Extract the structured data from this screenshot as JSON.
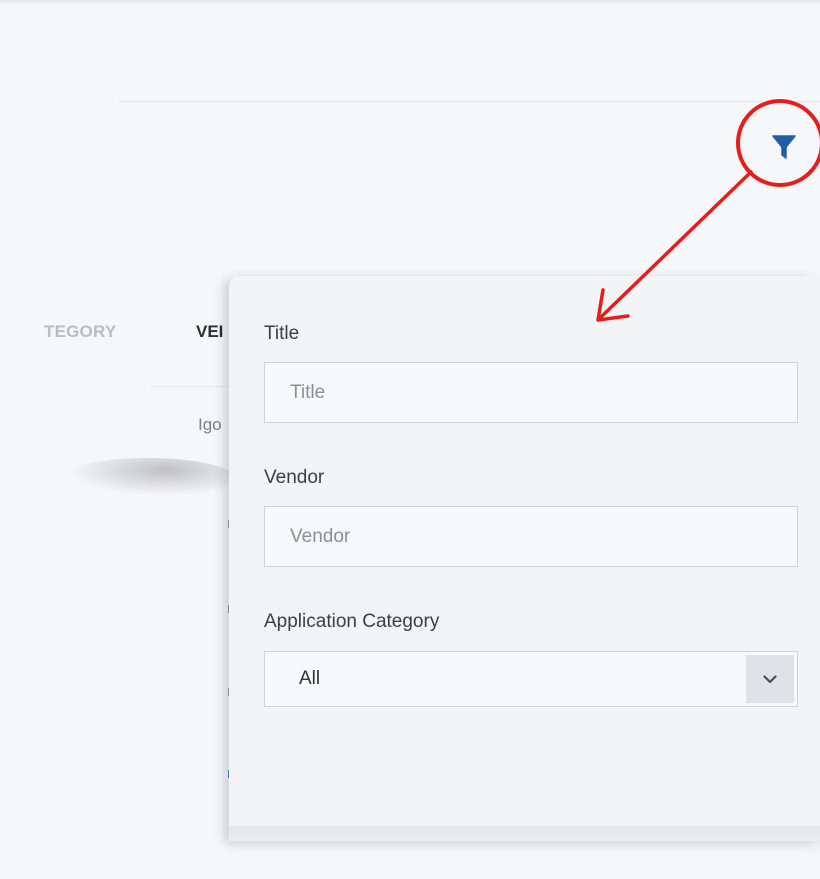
{
  "background": {
    "category_header": "TEGORY",
    "vendor_header": "VEI",
    "vendor_cell": "Igo"
  },
  "filter_button": {
    "icon": "filter-icon",
    "icon_color": "#1f5fa8"
  },
  "annotation": {
    "color": "#e51d1d",
    "shape": "circle-with-arrow"
  },
  "filter_panel": {
    "fields": {
      "title": {
        "label": "Title",
        "placeholder": "Title",
        "value": ""
      },
      "vendor": {
        "label": "Vendor",
        "placeholder": "Vendor",
        "value": ""
      },
      "application_category": {
        "label": "Application Category",
        "selected": "All",
        "icon": "chevron-down-icon"
      }
    }
  }
}
